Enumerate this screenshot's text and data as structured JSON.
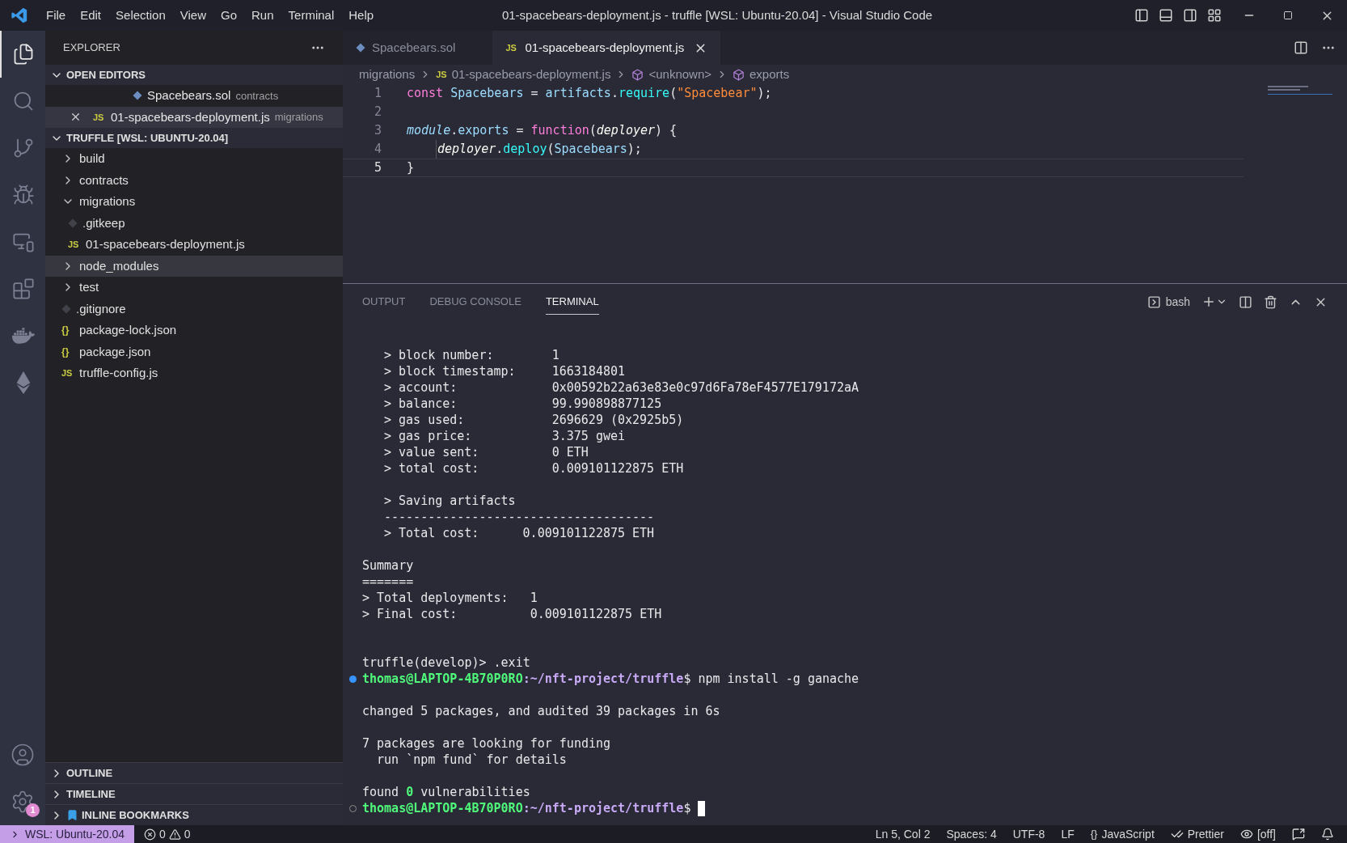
{
  "menu": [
    "File",
    "Edit",
    "Selection",
    "View",
    "Go",
    "Run",
    "Terminal",
    "Help"
  ],
  "window": {
    "title": "01-spacebears-deployment.js - truffle [WSL: Ubuntu-20.04] - Visual Studio Code"
  },
  "activity_bar": [
    {
      "kind": "explorer",
      "selected": true
    },
    {
      "kind": "search",
      "selected": false
    },
    {
      "kind": "source-control",
      "selected": false
    },
    {
      "kind": "run-debug",
      "selected": false
    },
    {
      "kind": "remote",
      "selected": false
    },
    {
      "kind": "extensions",
      "selected": false
    },
    {
      "kind": "docker",
      "selected": false
    },
    {
      "kind": "ethereum",
      "selected": false
    }
  ],
  "activity_bottom": [
    {
      "kind": "account"
    },
    {
      "kind": "settings",
      "badge": "1"
    }
  ],
  "sidebar": {
    "title": "EXPLORER",
    "open_editors": {
      "title": "OPEN EDITORS",
      "expanded": true,
      "items": [
        {
          "name": "Spacebears.sol",
          "folder": "contracts",
          "kind": "sol",
          "selected": false
        },
        {
          "name": "01-spacebears-deployment.js",
          "folder": "migrations",
          "kind": "js",
          "glyph": "JS",
          "selected": true
        }
      ]
    },
    "workspace": {
      "title": "TRUFFLE [WSL: UBUNTU-20.04]",
      "expanded": true,
      "items": [
        {
          "name": "build",
          "kind": "folder",
          "expanded": false,
          "selected": false
        },
        {
          "name": "contracts",
          "kind": "folder",
          "expanded": false,
          "selected": false
        },
        {
          "name": "migrations",
          "kind": "folder",
          "expanded": true,
          "selected": false,
          "children": [
            {
              "name": ".gitkeep",
              "kind": "git",
              "selected": false
            },
            {
              "name": "01-spacebears-deployment.js",
              "kind": "js",
              "glyph": "JS",
              "selected": false
            }
          ]
        },
        {
          "name": "node_modules",
          "kind": "folder",
          "expanded": false,
          "selected": true
        },
        {
          "name": "test",
          "kind": "folder",
          "expanded": false,
          "selected": false
        },
        {
          "name": ".gitignore",
          "kind": "git",
          "selected": false
        },
        {
          "name": "package-lock.json",
          "kind": "json",
          "glyph": "{}",
          "selected": false
        },
        {
          "name": "package.json",
          "kind": "json",
          "glyph": "{}",
          "selected": false
        },
        {
          "name": "truffle-config.js",
          "kind": "js",
          "glyph": "JS",
          "selected": false
        }
      ]
    },
    "sections": [
      {
        "title": "OUTLINE",
        "kind": "plain",
        "expanded": false
      },
      {
        "title": "TIMELINE",
        "kind": "plain",
        "expanded": false
      },
      {
        "title": "INLINE BOOKMARKS",
        "kind": "bookmarks",
        "expanded": false
      }
    ]
  },
  "tabs": [
    {
      "label": "Spacebears.sol",
      "kind": "sol",
      "selected": false
    },
    {
      "label": "01-spacebears-deployment.js",
      "kind": "js",
      "glyph": "JS",
      "selected": true
    }
  ],
  "breadcrumbs": [
    {
      "text": "migrations",
      "kind": "folder"
    },
    {
      "text": "01-spacebears-deployment.js",
      "kind": "file",
      "glyph": "JS"
    },
    {
      "text": "<unknown>",
      "kind": "symbol"
    },
    {
      "text": "exports",
      "kind": "symbol"
    }
  ],
  "code": [
    {
      "number": "1",
      "current": false,
      "indent": false,
      "tokens": [
        {
          "kind": "keyword",
          "text": "const "
        },
        {
          "kind": "name",
          "text": "Spacebears"
        },
        {
          "kind": "plain",
          "text": " = "
        },
        {
          "kind": "name",
          "text": "artifacts"
        },
        {
          "kind": "plain",
          "text": "."
        },
        {
          "kind": "function",
          "text": "require"
        },
        {
          "kind": "plain",
          "text": "("
        },
        {
          "kind": "string",
          "text": "\"Spacebear\""
        },
        {
          "kind": "plain",
          "text": ");"
        }
      ]
    },
    {
      "number": "2",
      "current": false,
      "indent": false
    },
    {
      "number": "3",
      "current": false,
      "indent": false,
      "tokens": [
        {
          "kind": "italic",
          "text": "module"
        },
        {
          "kind": "plain",
          "text": "."
        },
        {
          "kind": "name",
          "text": "exports"
        },
        {
          "kind": "plain",
          "text": " = "
        },
        {
          "kind": "keyword",
          "text": "function"
        },
        {
          "kind": "plain",
          "text": "("
        },
        {
          "kind": "param",
          "text": "deployer"
        },
        {
          "kind": "plain",
          "text": ") {"
        }
      ]
    },
    {
      "number": "4",
      "current": false,
      "indent": true,
      "tokens": [
        {
          "kind": "param",
          "text": "deployer"
        },
        {
          "kind": "plain",
          "text": "."
        },
        {
          "kind": "function",
          "text": "deploy"
        },
        {
          "kind": "plain",
          "text": "("
        },
        {
          "kind": "name",
          "text": "Spacebears"
        },
        {
          "kind": "plain",
          "text": ");"
        }
      ]
    },
    {
      "number": "5",
      "current": true,
      "indent": false,
      "tokens": [
        {
          "kind": "plain",
          "text": "}"
        }
      ]
    }
  ],
  "panel": {
    "tabs": [
      {
        "label": "OUTPUT",
        "selected": false
      },
      {
        "label": "DEBUG CONSOLE",
        "selected": false
      },
      {
        "label": "TERMINAL",
        "selected": true
      }
    ],
    "shell": "bash",
    "terminal": [
      {
        "kind": "text",
        "indent": true,
        "text": "> block number:        1"
      },
      {
        "kind": "text",
        "indent": true,
        "text": "> block timestamp:     1663184801"
      },
      {
        "kind": "text",
        "indent": true,
        "text": "> account:             0x00592b22a63e83e0c97d6Fa78eF4577E179172aA"
      },
      {
        "kind": "text",
        "indent": true,
        "text": "> balance:             99.990898877125"
      },
      {
        "kind": "text",
        "indent": true,
        "text": "> gas used:            2696629 (0x2925b5)"
      },
      {
        "kind": "text",
        "indent": true,
        "text": "> gas price:           3.375 gwei"
      },
      {
        "kind": "text",
        "indent": true,
        "text": "> value sent:          0 ETH"
      },
      {
        "kind": "text",
        "indent": true,
        "text": "> total cost:          0.009101122875 ETH"
      },
      {
        "kind": "blank"
      },
      {
        "kind": "text",
        "indent": true,
        "text": "> Saving artifacts"
      },
      {
        "kind": "text",
        "indent": true,
        "text": "-------------------------------------"
      },
      {
        "kind": "text",
        "indent": true,
        "text": "> Total cost:      0.009101122875 ETH"
      },
      {
        "kind": "blank"
      },
      {
        "kind": "text",
        "indent": false,
        "text": "Summary"
      },
      {
        "kind": "text",
        "indent": false,
        "text": "======="
      },
      {
        "kind": "text",
        "indent": false,
        "text": "> Total deployments:   1"
      },
      {
        "kind": "text",
        "indent": false,
        "text": "> Final cost:          0.009101122875 ETH"
      },
      {
        "kind": "blank"
      },
      {
        "kind": "blank"
      },
      {
        "kind": "text",
        "indent": false,
        "text": "truffle(develop)> .exit"
      },
      {
        "kind": "prompt",
        "finished": true,
        "user": "thomas@LAPTOP-4B70P0RO",
        "path": ":~/nft-project/truffle",
        "dollar": "$",
        "command": " npm install -g ganache",
        "cursor": false
      },
      {
        "kind": "blank"
      },
      {
        "kind": "text",
        "indent": false,
        "text": "changed 5 packages, and audited 39 packages in 6s"
      },
      {
        "kind": "blank"
      },
      {
        "kind": "text",
        "indent": false,
        "text": "7 packages are looking for funding"
      },
      {
        "kind": "text",
        "indent": false,
        "text": "  run `npm fund` for details"
      },
      {
        "kind": "blank"
      },
      {
        "kind": "text",
        "indent": false,
        "text": "found **0** vulnerabilities"
      },
      {
        "kind": "prompt",
        "finished": false,
        "user": "thomas@LAPTOP-4B70P0RO",
        "path": ":~/nft-project/truffle",
        "dollar": "$",
        "cursor": true
      }
    ]
  },
  "status_bar": {
    "remote": "WSL: Ubuntu-20.04",
    "errors": "0",
    "warnings": "0",
    "right": [
      {
        "kind": "text",
        "text": "Ln 5, Col 2"
      },
      {
        "kind": "text",
        "text": "Spaces: 4"
      },
      {
        "kind": "text",
        "text": "UTF-8"
      },
      {
        "kind": "text",
        "text": "LF"
      },
      {
        "kind": "language",
        "glyph": "{}",
        "text": "JavaScript"
      },
      {
        "kind": "prettier",
        "text": "Prettier"
      },
      {
        "kind": "eye",
        "text": "[off]"
      },
      {
        "kind": "feedback"
      },
      {
        "kind": "bell"
      }
    ]
  }
}
